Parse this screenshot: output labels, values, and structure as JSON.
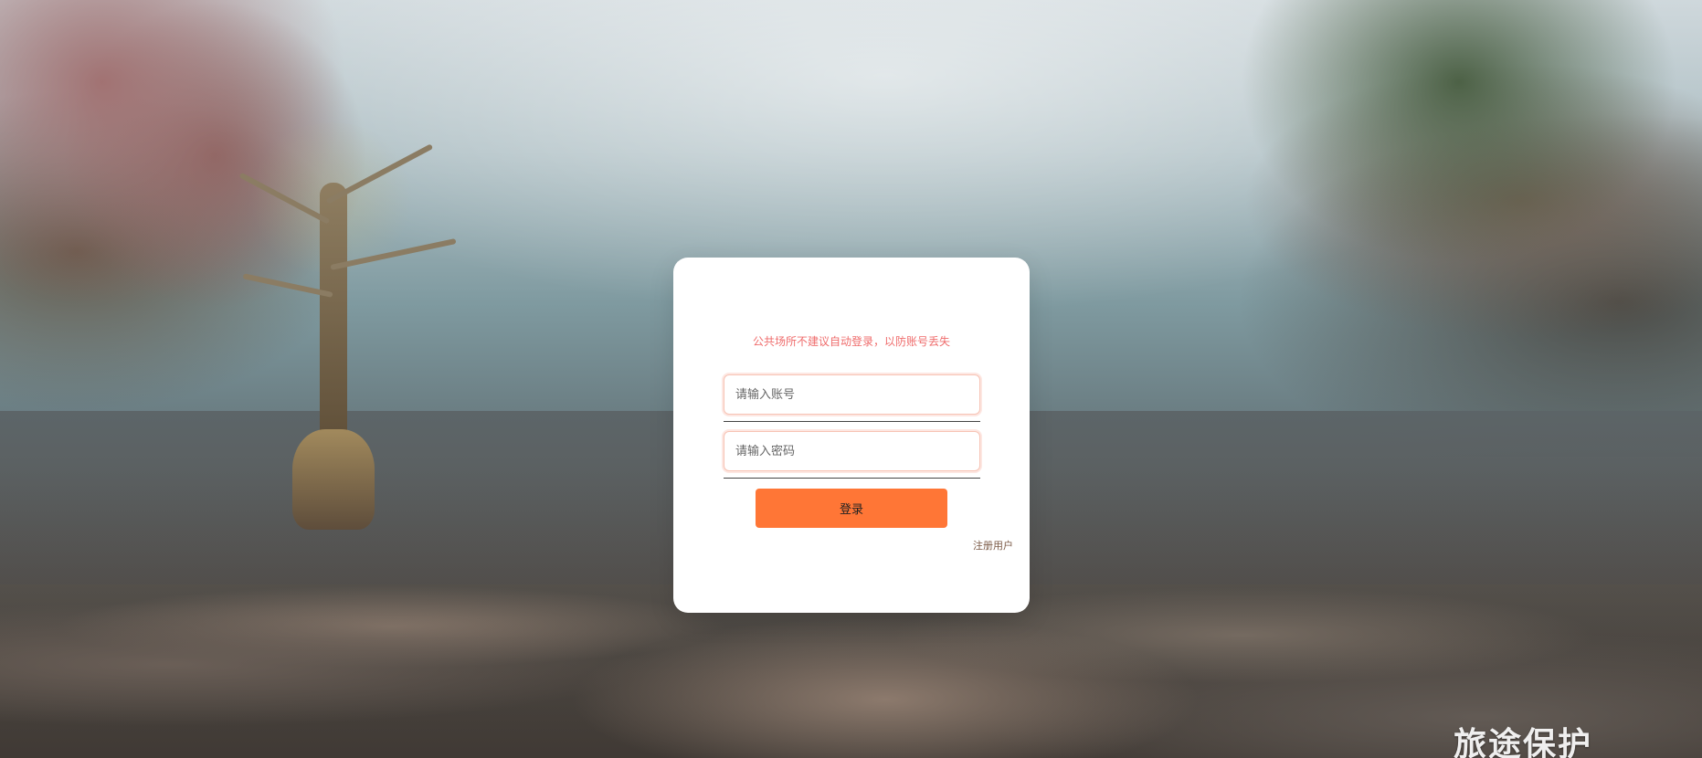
{
  "background": {
    "scene": "river-landscape",
    "corner_caption": "旅途保护"
  },
  "login": {
    "warning_text": "公共场所不建议自动登录，以防账号丢失",
    "account_placeholder": "请输入账号",
    "password_placeholder": "请输入密码",
    "login_button_label": "登录",
    "register_link_label": "注册用户"
  },
  "colors": {
    "accent": "#ff7636",
    "warning": "#ef6c6c"
  }
}
